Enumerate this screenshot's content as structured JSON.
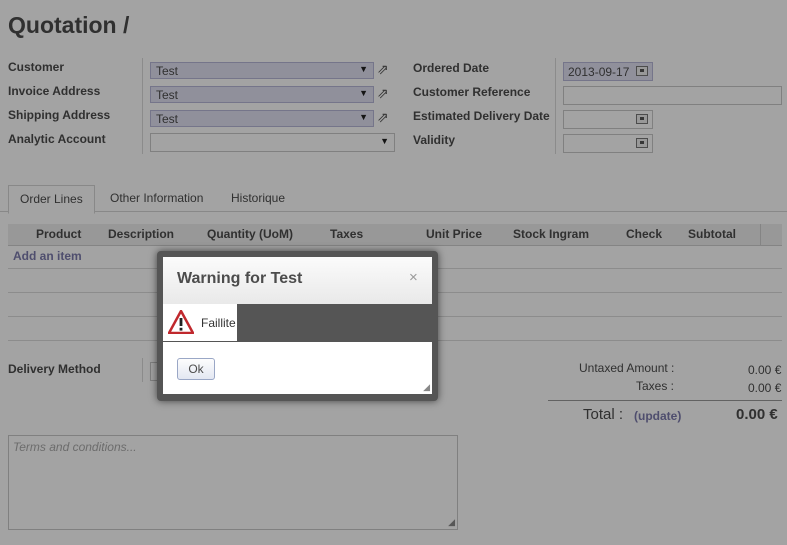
{
  "page": {
    "title": "Quotation /"
  },
  "form": {
    "left": [
      {
        "label": "Customer",
        "value": "Test"
      },
      {
        "label": "Invoice Address",
        "value": "Test"
      },
      {
        "label": "Shipping Address",
        "value": "Test"
      },
      {
        "label": "Analytic Account",
        "value": ""
      }
    ],
    "right": [
      {
        "label": "Ordered Date",
        "value": "2013-09-17"
      },
      {
        "label": "Customer Reference",
        "value": ""
      },
      {
        "label": "Estimated Delivery Date",
        "value": ""
      },
      {
        "label": "Validity",
        "value": ""
      }
    ]
  },
  "tabs": [
    "Order Lines",
    "Other Information",
    "Historique"
  ],
  "table": {
    "headers": [
      "Product",
      "Description",
      "Quantity (UoM)",
      "Taxes",
      "Unit Price",
      "Stock Ingram",
      "Check",
      "Subtotal"
    ],
    "add_item": "Add an item"
  },
  "footer": {
    "delivery_label": "Delivery Method",
    "untaxed_label": "Untaxed Amount :",
    "untaxed_value": "0.00 €",
    "taxes_label": "Taxes :",
    "taxes_value": "0.00 €",
    "total_label": "Total :",
    "update_label": "(update)",
    "total_value": "0.00 €",
    "terms_placeholder": "Terms and conditions..."
  },
  "dialog": {
    "title": "Warning for Test",
    "close": "×",
    "message": "Faillite",
    "ok_label": "Ok",
    "warning_icon": "warning-triangle-icon"
  },
  "colors": {
    "many2one_bg": "#e2e2f3",
    "link": "#7c7bad"
  }
}
